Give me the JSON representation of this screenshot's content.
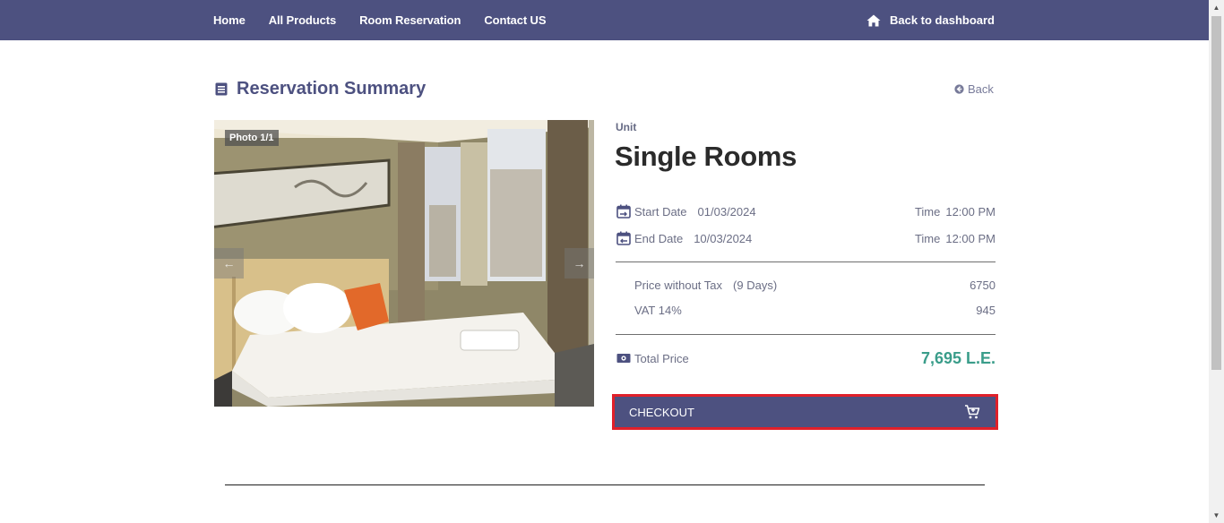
{
  "nav": {
    "links": [
      "Home",
      "All Products",
      "Room Reservation",
      "Contact US"
    ],
    "dashboard_label": "Back to dashboard"
  },
  "summary": {
    "title": "Reservation Summary",
    "back_label": "Back"
  },
  "photo": {
    "badge": "Photo 1/1"
  },
  "unit": {
    "label": "Unit",
    "name": "Single Rooms"
  },
  "dates": {
    "start_label": "Start Date",
    "start_value": "01/03/2024",
    "end_label": "End Date",
    "end_value": "10/03/2024",
    "time_label": "Time",
    "start_time": "12:00 PM",
    "end_time": "12:00 PM"
  },
  "pricing": {
    "without_tax_label": "Price without Tax",
    "days": "(9 Days)",
    "without_tax_value": "6750",
    "vat_label": "VAT 14%",
    "vat_value": "945",
    "total_label": "Total Price",
    "total_value": "7,695 L.E."
  },
  "checkout": {
    "label": "CHECKOUT"
  },
  "colors": {
    "brand": "#4d5180",
    "total": "#3a9d8a",
    "highlight": "#e0202a"
  },
  "icons": {
    "dashboard": "home-icon",
    "title": "list-icon",
    "back": "arrow-circle-left-icon",
    "start_date": "calendar-icon",
    "end_date": "calendar-icon",
    "total": "money-icon",
    "checkout": "cart-plus-icon"
  }
}
